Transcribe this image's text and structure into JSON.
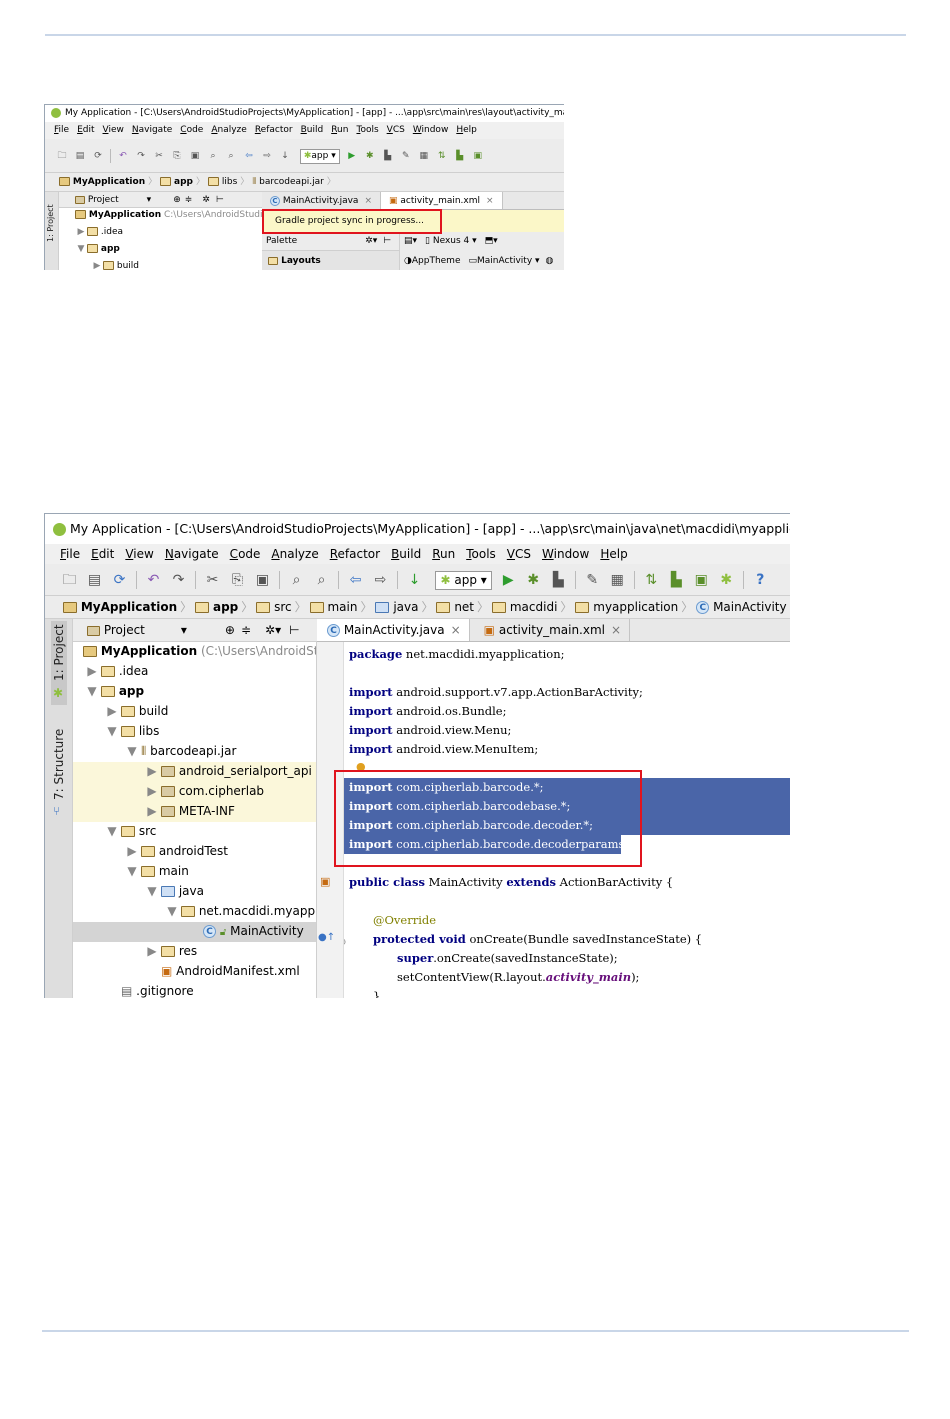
{
  "screenshot1": {
    "title": "My Application - [C:\\Users\\AndroidStudioProjects\\MyApplication] - [app] - ...\\app\\src\\main\\res\\layout\\activity_main",
    "menu": [
      "File",
      "Edit",
      "View",
      "Navigate",
      "Code",
      "Analyze",
      "Refactor",
      "Build",
      "Run",
      "Tools",
      "VCS",
      "Window",
      "Help"
    ],
    "run_config": "app ▾",
    "breadcrumbs": [
      "MyApplication",
      "app",
      "libs",
      "barcodeapi.jar"
    ],
    "project_header": "Project",
    "project_selector": "▾",
    "side_tab": "1: Project",
    "tree": [
      {
        "label": "MyApplication",
        "hint": "C:\\Users\\AndroidStudio"
      },
      {
        "label": ".idea"
      },
      {
        "label": "app"
      },
      {
        "label": "build"
      }
    ],
    "tabs": [
      {
        "label": "MainActivity.java",
        "close": "×"
      },
      {
        "label": "activity_main.xml",
        "close": "×"
      }
    ],
    "notification": "Gradle project sync in progress...",
    "palette_label": "Palette",
    "layouts_label": "Layouts",
    "device_label": "Nexus 4 ▾",
    "theme_label": "AppTheme",
    "activity_label": "MainActivity ▾"
  },
  "screenshot2": {
    "title": "My Application - [C:\\Users\\AndroidStudioProjects\\MyApplication] - [app] - ...\\app\\src\\main\\java\\net\\macdidi\\myapplication\\MainActivity",
    "menu": [
      "File",
      "Edit",
      "View",
      "Navigate",
      "Code",
      "Analyze",
      "Refactor",
      "Build",
      "Run",
      "Tools",
      "VCS",
      "Window",
      "Help"
    ],
    "run_config": "app ▾",
    "help_icon": "?",
    "breadcrumbs": [
      "MyApplication",
      "app",
      "src",
      "main",
      "java",
      "net",
      "macdidi",
      "myapplication",
      "MainActivity"
    ],
    "project_header": "Project",
    "project_selector": "▾",
    "side_tabs": [
      "1: Project",
      "7: Structure"
    ],
    "tree": [
      {
        "label": "MyApplication",
        "hint": "(C:\\Users\\AndroidStudioI"
      },
      {
        "label": ".idea"
      },
      {
        "label": "app"
      },
      {
        "label": "build"
      },
      {
        "label": "libs"
      },
      {
        "label": "barcodeapi.jar"
      },
      {
        "label": "android_serialport_api"
      },
      {
        "label": "com.cipherlab"
      },
      {
        "label": "META-INF"
      },
      {
        "label": "src"
      },
      {
        "label": "androidTest"
      },
      {
        "label": "main"
      },
      {
        "label": "java"
      },
      {
        "label": "net.macdidi.myapplic"
      },
      {
        "label": "MainActivity"
      },
      {
        "label": "res"
      },
      {
        "label": "AndroidManifest.xml"
      },
      {
        "label": ".gitignore"
      }
    ],
    "tabs": [
      {
        "label": "MainActivity.java",
        "close": "×"
      },
      {
        "label": "activity_main.xml",
        "close": "×"
      }
    ],
    "code": [
      {
        "kw": "package",
        "rest": " net.macdidi.myapplication;"
      },
      {
        "kw": "",
        "rest": ""
      },
      {
        "kw": "import",
        "rest": " android.support.v7.app.ActionBarActivity;"
      },
      {
        "kw": "import",
        "rest": " android.os.Bundle;"
      },
      {
        "kw": "import",
        "rest": " android.view.Menu;"
      },
      {
        "kw": "import",
        "rest": " android.view.MenuItem;"
      },
      {
        "kw": "",
        "rest": ""
      },
      {
        "kw": "import",
        "rest": " com.cipherlab.barcode.*;"
      },
      {
        "kw": "import",
        "rest": " com.cipherlab.barcodebase.*;"
      },
      {
        "kw": "import",
        "rest": " com.cipherlab.barcode.decoder.*;"
      },
      {
        "kw": "import",
        "rest": " com.cipherlab.barcode.decoderparams.*;"
      },
      {
        "kw": "",
        "rest": ""
      },
      {
        "kw": "public class",
        "rest": " MainActivity ",
        "kw2": "extends",
        "rest2": " ActionBarActivity {"
      },
      {
        "kw": "",
        "rest": ""
      },
      {
        "kw": "",
        "rest": "@Override"
      },
      {
        "kw": "protected void",
        "rest": " onCreate(Bundle savedInstanceState) {"
      },
      {
        "kw": "super",
        "rest": ".onCreate(savedInstanceState);"
      },
      {
        "kw": "",
        "rest": "setContentView(R.layout.",
        "it": "activity_main",
        "rest2": ");"
      },
      {
        "kw": "",
        "rest": "}"
      }
    ]
  },
  "colors": {
    "highlight": "#4a65a8",
    "redbox": "#e0141e",
    "libs_tint": "#fbf7da"
  }
}
